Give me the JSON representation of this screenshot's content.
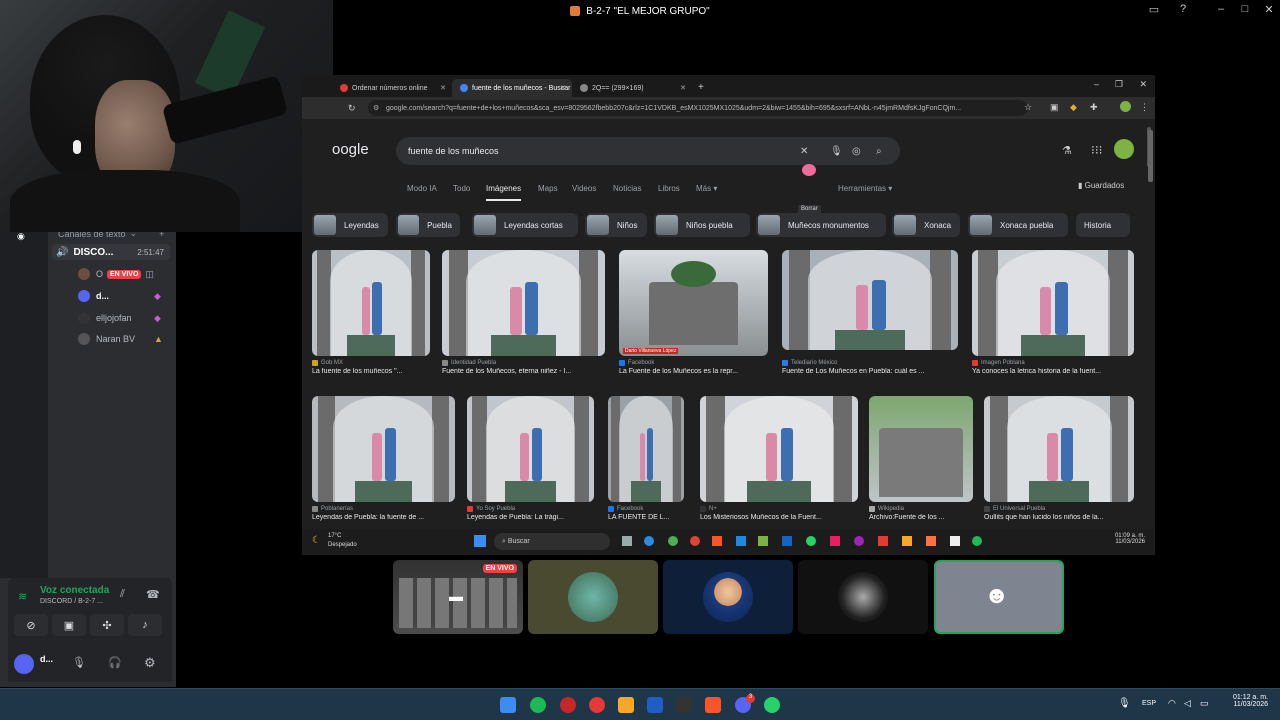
{
  "discord": {
    "window_title": "B-2-7 \"EL MEJOR GRUPO\"",
    "text_channels_label": "Canales de texto",
    "voice_channel": {
      "name": "DISCO...",
      "timer": "2:51:47"
    },
    "voice_users": [
      {
        "name": "O",
        "badge": "EN VIVO",
        "avatar_color": "#6d4c41"
      },
      {
        "name": "d...",
        "avatar_color": "#5865f2"
      },
      {
        "name": "elljojofan",
        "avatar_color": "#333333"
      },
      {
        "name": "Naran BV",
        "avatar_color": "#555555"
      }
    ],
    "voice_panel": {
      "status": "Voz conectada",
      "channel": "DISCORD / B-2-7 ..."
    },
    "user_panel": {
      "name": "d..."
    },
    "live_badge": "EN VIVO"
  },
  "browser": {
    "tabs": [
      {
        "label": "Ordenar números online",
        "color": "#e53935"
      },
      {
        "label": "fuente de los muñecos - Buscar",
        "color": "#4285f4"
      },
      {
        "label": "2Q== (299×169)",
        "color": "#888888"
      }
    ],
    "url": "google.com/search?q=fuente+de+los+muñecos&sca_esv=8029562fbebb207c&rlz=1C1VDKB_esMX1025MX1025&udm=2&biw=1455&bih=695&sxsrf=ANbL-n45jmRMdfsKJgFonCQjm...",
    "logo": "oogle",
    "search_query": "fuente de los muñecos",
    "tooltip": "Borrar",
    "nav": [
      "Modo IA",
      "Todo",
      "Imágenes",
      "Maps",
      "Videos",
      "Noticias",
      "Libros",
      "Más ▾"
    ],
    "tools": "Herramientas ▾",
    "saved": "Guardados",
    "chips": [
      "Leyendas",
      "Puebla",
      "Leyendas cortas",
      "Niños",
      "Niños puebla",
      "Muñecos monumentos",
      "Xonaca",
      "Xonaca puebla",
      "Historia"
    ],
    "results_row1": [
      {
        "source": "Gob MX",
        "caption": "La fuente de los muñecos \"...",
        "src_color": "#c9a227"
      },
      {
        "source": "Identidad Puebla",
        "caption": "Fuente de los Muñecos, eterna niñez - I...",
        "src_color": "#888888"
      },
      {
        "source": "Facebook",
        "caption": "La Fuente de los Muñecos es la repr...",
        "src_color": "#1877f2"
      },
      {
        "source": "Telediario México",
        "caption": "Fuente de Los Muñecos en Puebla: cuál es ...",
        "src_color": "#2c7be5"
      },
      {
        "source": "Imagen Poblana",
        "caption": "Ya conoces la letrica historia de la fuent...",
        "src_color": "#e53935"
      }
    ],
    "results_row2": [
      {
        "source": "Poblanerías",
        "caption": "Leyendas de Puebla: la fuente de ...",
        "src_color": "#888888"
      },
      {
        "source": "Yo Soy Puebla",
        "caption": "Leyendas de Puebla: La trági...",
        "src_color": "#e53935"
      },
      {
        "source": "Facebook",
        "caption": "LA FUENTE DE L...",
        "src_color": "#1877f2"
      },
      {
        "source": "N+",
        "caption": "Los Misteriosos Muñecos de la Fuent...",
        "src_color": "#333333"
      },
      {
        "source": "Wikipedia",
        "caption": "Archivo:Fuente de los ...",
        "src_color": "#aaaaaa"
      },
      {
        "source": "El Universal Puebla",
        "caption": "Oullits que han lucido los niños de la...",
        "src_color": "#444444"
      }
    ],
    "overlay_text": "Dario Villanueva López",
    "inner_taskbar": {
      "weather_temp": "17°C",
      "weather_desc": "Despejado",
      "search": "Buscar",
      "time": "01:09 a. m.",
      "date": "11/03/2026"
    }
  },
  "taskbar": {
    "lang": "ESP",
    "time": "01:12 a. m.",
    "date": "11/03/2026",
    "badge": "3"
  }
}
